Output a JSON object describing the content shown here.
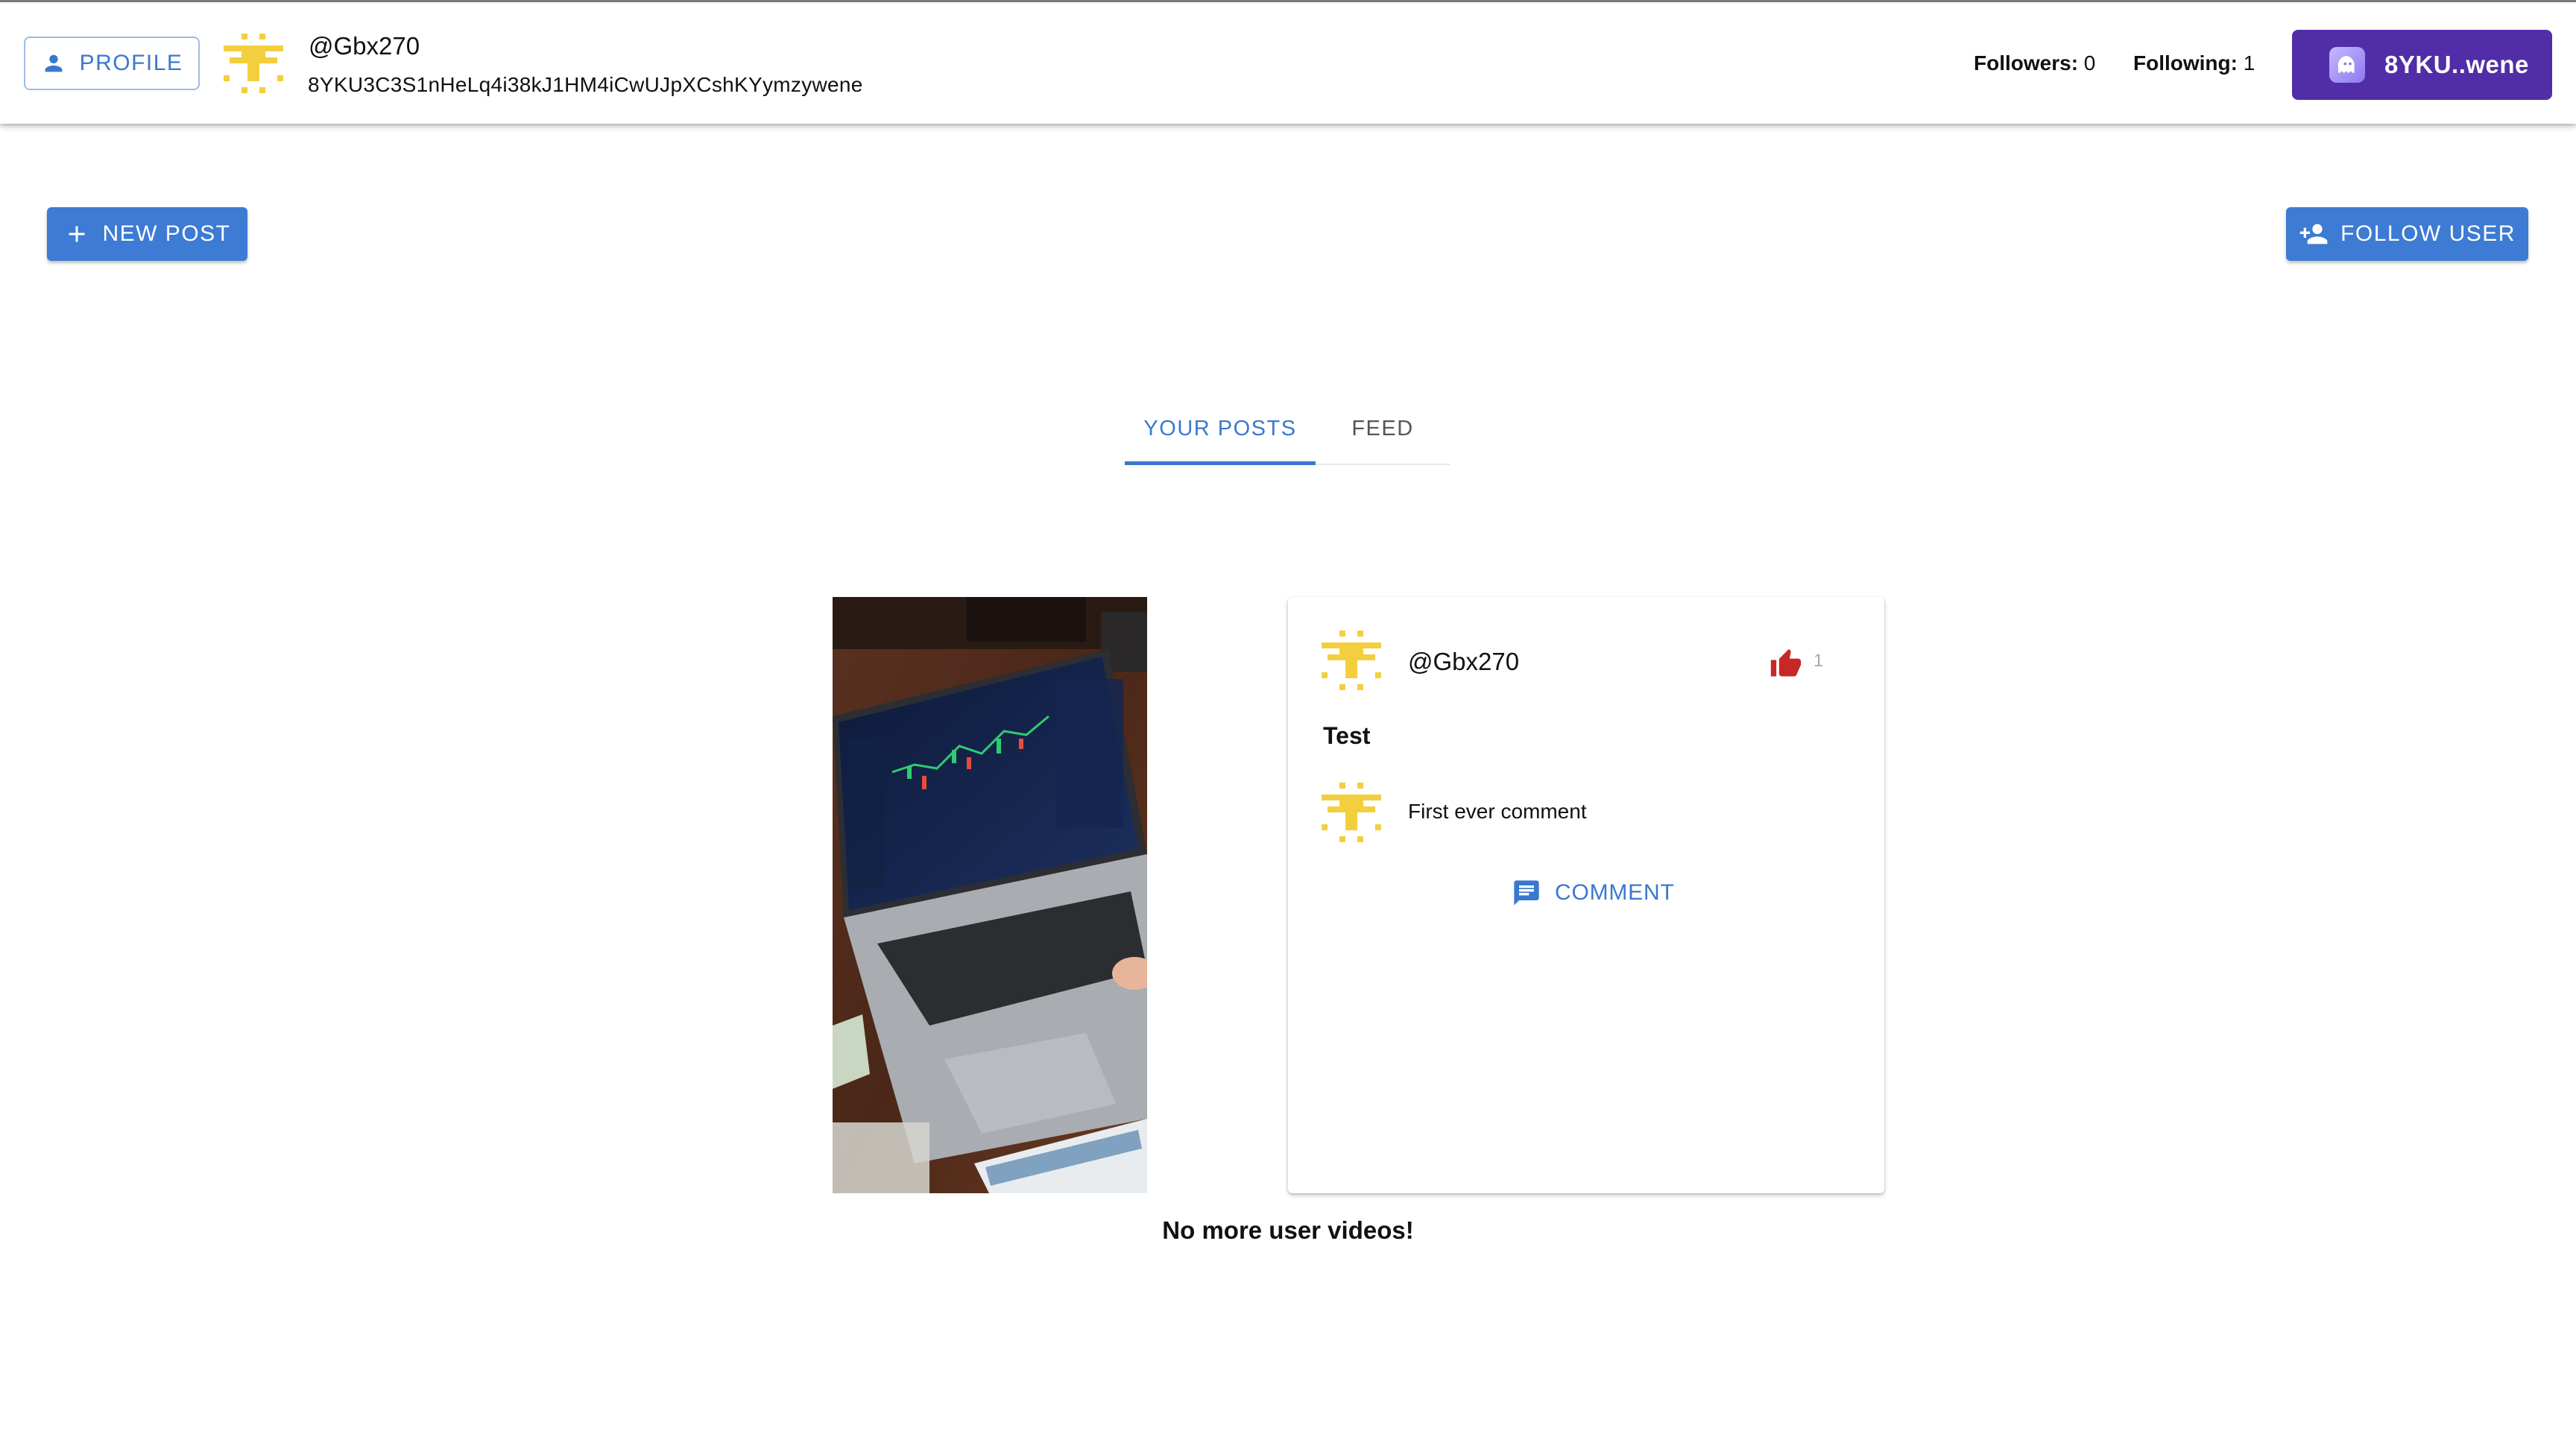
{
  "header": {
    "profile_label": "PROFILE",
    "username": "@Gbx270",
    "address": "8YKU3C3S1nHeLq4i38kJ1HM4iCwUJpXCshKYymzywene",
    "followers_label": "Followers:",
    "followers_count": "0",
    "following_label": "Following:",
    "following_count": "1",
    "wallet_label": "8YKU..wene"
  },
  "actions": {
    "new_post_label": "NEW POST",
    "follow_user_label": "FOLLOW USER"
  },
  "tabs": [
    {
      "label": "YOUR POSTS",
      "active": true
    },
    {
      "label": "FEED",
      "active": false
    }
  ],
  "post": {
    "username": "@Gbx270",
    "likes": "1",
    "title": "Test",
    "comments": [
      {
        "text": "First ever comment"
      }
    ],
    "comment_button_label": "COMMENT"
  },
  "end_message": "No more user videos!",
  "colors": {
    "primary": "#3d7bd4",
    "wallet": "#512da8",
    "avatar_yellow": "#f3cf3f",
    "like_red": "#c62828"
  },
  "icons": {
    "profile": "person-icon",
    "wallet": "ghost-wallet-icon",
    "new_post": "plus-icon",
    "follow": "person-add-icon",
    "like": "thumb-up-icon",
    "comment": "comment-icon"
  }
}
